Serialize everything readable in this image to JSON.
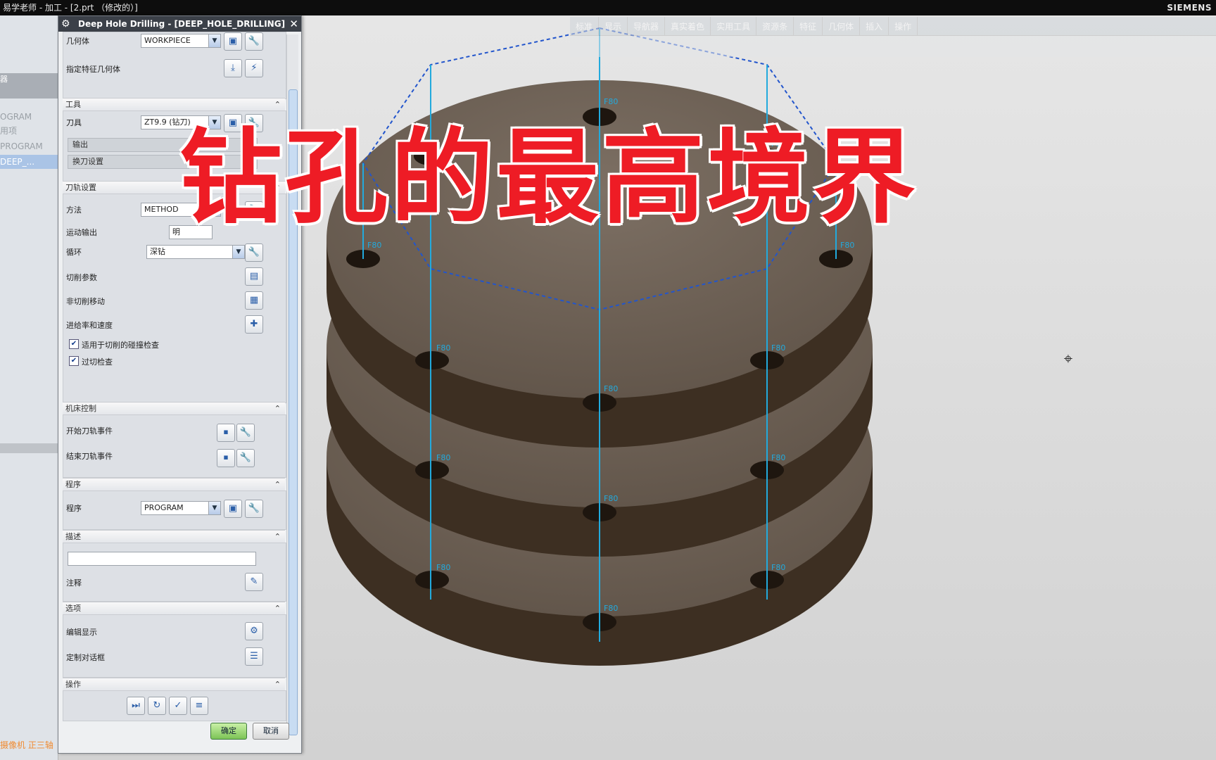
{
  "window": {
    "title": "易学老师 - 加工 - [2.prt （修改的）]",
    "brand": "SIEMENS"
  },
  "navigator": {
    "header": "器",
    "items": [
      "OGRAM",
      "用项",
      "PROGRAM",
      "DEEP_..."
    ],
    "footer": "摄像机 正三轴"
  },
  "top_toolbar": {
    "tabs": [
      "标准",
      "显示",
      "导航器",
      "真实着色",
      "实用工具",
      "资源条",
      "特征",
      "几何体",
      "插入",
      "操作"
    ]
  },
  "dialog": {
    "title": "Deep Hole Drilling - [DEEP_HOLE_DRILLING]",
    "geometry": {
      "label": "几何体",
      "value": "WORKPIECE",
      "feature_label": "指定特征几何体"
    },
    "tool": {
      "header": "工具",
      "label": "刀具",
      "value": "ZT9.9 (钻刀)",
      "output": "输出",
      "tool_change": "换刀设置"
    },
    "path": {
      "header": "刀轨设置",
      "method_label": "方法",
      "method_value": "METHOD",
      "motion_output_label": "运动输出",
      "motion_output_value": "明",
      "cycle_label": "循环",
      "cycle_value": "深钻",
      "cut_params": "切削参数",
      "non_cut": "非切削移动",
      "feeds": "进给率和速度",
      "gouge_check": "适用于切削的碰撞检查",
      "overcut_check": "过切检查",
      "gouge_checked": true,
      "overcut_checked": true
    },
    "machine": {
      "header": "机床控制",
      "start_event": "开始刀轨事件",
      "end_event": "结束刀轨事件"
    },
    "program": {
      "header": "程序",
      "label": "程序",
      "value": "PROGRAM"
    },
    "description": {
      "header": "描述",
      "value": "",
      "comment": "注释"
    },
    "options": {
      "header": "选项",
      "edit_display": "编辑显示",
      "custom_dialog": "定制对话框"
    },
    "actions": {
      "header": "操作"
    },
    "ok": "确定",
    "cancel": "取消"
  },
  "model": {
    "feed_label": "F80",
    "plate_color": "#4a3a2c",
    "top_color": "#6b5e52",
    "path_color": "#2255cc",
    "axis_color": "#22aadd"
  },
  "overlay_title": "钻孔的最高境界"
}
